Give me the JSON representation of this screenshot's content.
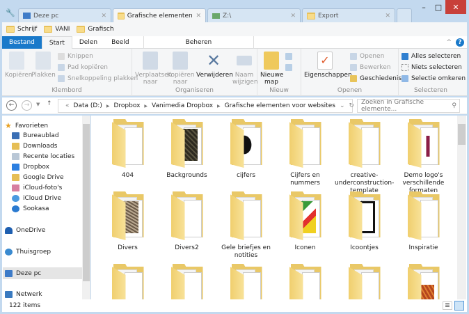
{
  "window": {
    "tabs": [
      {
        "label": "Deze pc",
        "icon": "computer-icon",
        "active": false
      },
      {
        "label": "Grafische elementen voor",
        "icon": "folder-icon",
        "active": true
      },
      {
        "label": "Z:\\",
        "icon": "network-drive-icon",
        "active": false
      },
      {
        "label": "Export",
        "icon": "folder-icon",
        "active": false
      }
    ],
    "controls": {
      "minimize": "–",
      "maximize": "□",
      "close": "✕"
    }
  },
  "quick_access": [
    {
      "label": "Schrijf"
    },
    {
      "label": "VANI"
    },
    {
      "label": "Grafisch"
    }
  ],
  "ribbon_tabs": {
    "file": "Bestand",
    "start": "Start",
    "share": "Delen",
    "view": "Beeld",
    "manage": "Beheren"
  },
  "ribbon": {
    "clipboard": {
      "label": "Klembord",
      "copy": "Kopiëren",
      "paste": "Plakken",
      "cut": "Knippen",
      "copy_path": "Pad kopiëren",
      "paste_shortcut": "Snelkoppeling plakken"
    },
    "organize": {
      "label": "Organiseren",
      "move_to": "Verplaatsen naar",
      "copy_to": "Kopiëren naar",
      "delete": "Verwijderen",
      "rename": "Naam wijzigen"
    },
    "new": {
      "label": "Nieuw",
      "new_folder": "Nieuwe map"
    },
    "open": {
      "label": "Openen",
      "properties": "Eigenschappen",
      "open": "Openen",
      "edit": "Bewerken",
      "history": "Geschiedenis"
    },
    "select": {
      "label": "Selecteren",
      "select_all": "Alles selecteren",
      "select_none": "Niets selecteren",
      "invert": "Selectie omkeren"
    }
  },
  "address": {
    "crumbs": [
      "Data (D:)",
      "Dropbox",
      "Vanimedia Dropbox",
      "Grafische elementen voor websites"
    ],
    "search_placeholder": "Zoeken in Grafische elemente..."
  },
  "nav": {
    "favorites": "Favorieten",
    "items": [
      "Bureaublad",
      "Downloads",
      "Recente locaties",
      "Dropbox",
      "Google Drive",
      "iCloud-foto's",
      "iCloud Drive",
      "Sookasa"
    ],
    "onedrive": "OneDrive",
    "homegroup": "Thuisgroep",
    "this_pc": "Deze pc",
    "network": "Netwerk"
  },
  "folders": [
    {
      "name": "404",
      "preview": "docs"
    },
    {
      "name": "Backgrounds",
      "preview": "dark-texture"
    },
    {
      "name": "cijfers",
      "preview": "cijfers"
    },
    {
      "name": "Cijfers en nummers",
      "preview": "empty"
    },
    {
      "name": "creative-underconstruction-template",
      "preview": "docs"
    },
    {
      "name": "Demo logo's verschillende formaten",
      "preview": "logo"
    },
    {
      "name": "Divers",
      "preview": "stone"
    },
    {
      "name": "Divers2",
      "preview": "docs"
    },
    {
      "name": "Gele briefjes en notities",
      "preview": "docs"
    },
    {
      "name": "Iconen",
      "preview": "icons"
    },
    {
      "name": "Icoontjes",
      "preview": "icoontjes"
    },
    {
      "name": "Inspiratie",
      "preview": "docs"
    },
    {
      "name": "",
      "preview": "docs"
    },
    {
      "name": "",
      "preview": "docs"
    },
    {
      "name": "",
      "preview": "docs"
    },
    {
      "name": "",
      "preview": "docs"
    },
    {
      "name": "",
      "preview": "docs"
    },
    {
      "name": "",
      "preview": "red-texture"
    }
  ],
  "status": {
    "count": "122 items"
  }
}
